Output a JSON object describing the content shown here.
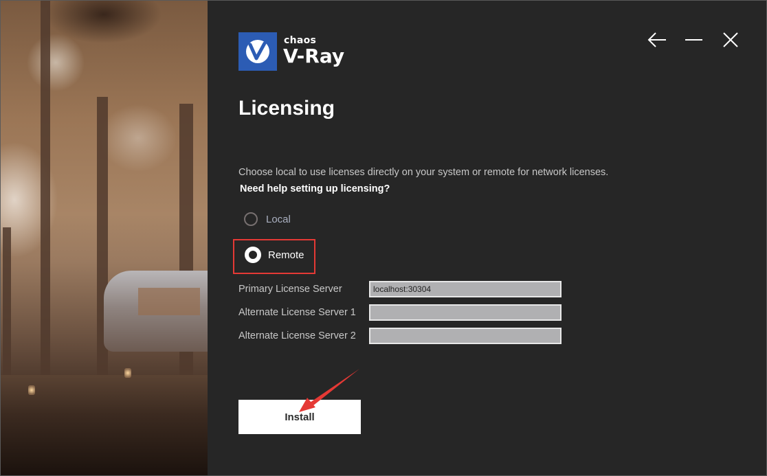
{
  "window": {
    "buttons": {
      "back_icon": "arrow-left-icon",
      "minimize_icon": "minimize-icon",
      "close_icon": "close-icon"
    }
  },
  "brand": {
    "company": "chaos",
    "product": "V-Ray",
    "logo_color": "#2c5cb4"
  },
  "page": {
    "title": "Licensing",
    "description": "Choose local to use licenses directly on your system or remote for network licenses.",
    "help_link": "Need help setting up licensing?"
  },
  "license_mode": {
    "options": [
      {
        "label": "Local",
        "selected": false
      },
      {
        "label": "Remote",
        "selected": true
      }
    ]
  },
  "servers": {
    "fields": [
      {
        "label": "Primary License Server",
        "value": "localhost:30304"
      },
      {
        "label": "Alternate License Server 1",
        "value": ""
      },
      {
        "label": "Alternate License Server 2",
        "value": ""
      }
    ]
  },
  "actions": {
    "install_label": "Install"
  },
  "annotations": {
    "highlight_color": "#e53935"
  }
}
